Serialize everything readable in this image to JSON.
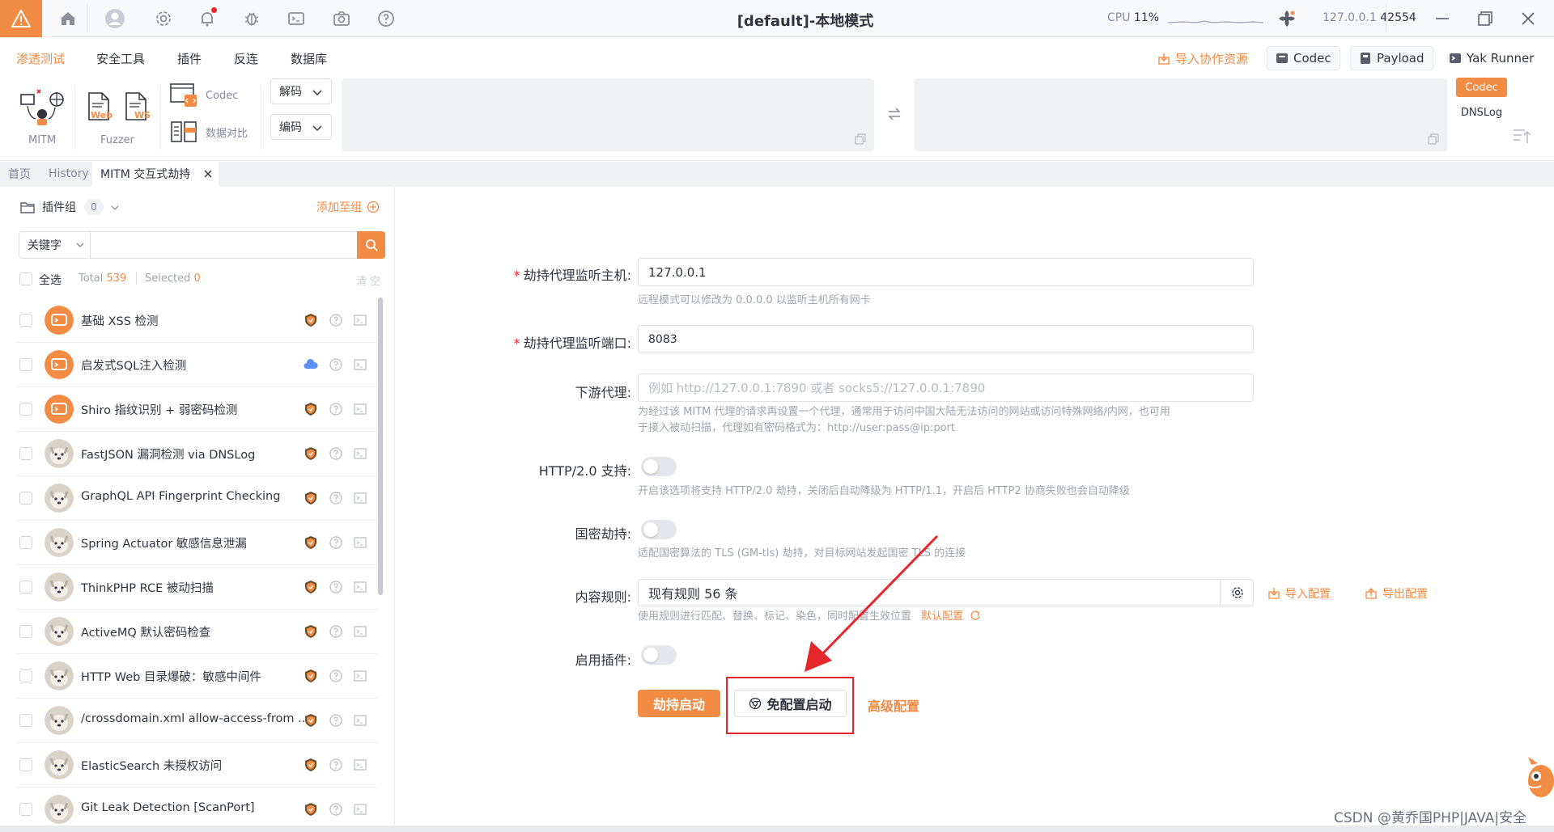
{
  "titlebar": {
    "title": "[default]-本地模式",
    "cpu_label": "CPU",
    "cpu_value": "11%",
    "host": "127.0.0.1",
    "port": "42554"
  },
  "menu": {
    "items": [
      "渗透测试",
      "安全工具",
      "插件",
      "反连",
      "数据库"
    ],
    "import_link": "导入协作资源",
    "codec_btn": "Codec",
    "payload_btn": "Payload",
    "yakrunner_btn": "Yak Runner"
  },
  "toolbar": {
    "mitm_label": "MITM",
    "web_label": "Web",
    "ws_label": "WS",
    "fuzzer_label": "Fuzzer",
    "codec_label": "Codec",
    "diff_label": "数据对比",
    "decode_select": "解码",
    "encode_select": "编码",
    "side_tab_codec": "Codec",
    "side_tab_dnslog": "DNSLog"
  },
  "tabs": [
    "首页",
    "History",
    "MITM 交互式劫持"
  ],
  "left": {
    "group_label": "插件组",
    "group_count": "0",
    "add_group": "添加至组",
    "keyword_select": "关键字",
    "select_all": "全选",
    "total_label": "Total",
    "total_value": "539",
    "selected_label": "Selected",
    "selected_value": "0",
    "clear": "清 空",
    "plugins": [
      "基础 XSS 检测",
      "启发式SQL注入检测",
      "Shiro 指纹识别 + 弱密码检测",
      "FastJSON 漏洞检测 via DNSLog",
      "GraphQL API Fingerprint Checking",
      "Spring Actuator 敏感信息泄漏",
      "ThinkPHP RCE 被动扫描",
      "ActiveMQ 默认密码检查",
      "HTTP Web 目录爆破：敏感中间件",
      "/crossdomain.xml allow-access-from ...",
      "ElasticSearch 未授权访问",
      "Git Leak Detection [ScanPort]"
    ]
  },
  "form": {
    "host_label": "劫持代理监听主机:",
    "host_value": "127.0.0.1",
    "host_help": "远程模式可以修改为 0.0.0.0 以监听主机所有网卡",
    "port_label": "劫持代理监听端口:",
    "port_value": "8083",
    "downstream_label": "下游代理:",
    "downstream_placeholder": "例如 http://127.0.0.1:7890 或者 socks5://127.0.0.1:7890",
    "downstream_help_1": "为经过该 MITM 代理的请求再设置一个代理，通常用于访问中国大陆无法访问的网站或访问特殊网络/内网，也可用",
    "downstream_help_2": "于接入被动扫描，代理如有密码格式为：http://user:pass@ip:port",
    "http2_label": "HTTP/2.0 支持:",
    "http2_help": "开启该选项将支持 HTTP/2.0 劫持，关闭后自动降级为 HTTP/1.1，开启后 HTTP2 协商失败也会自动降级",
    "gm_label": "国密劫持:",
    "gm_help": "适配国密算法的 TLS (GM-tls) 劫持，对目标网站发起国密 TLS 的连接",
    "rules_label": "内容规则:",
    "rules_value": "现有规则 56 条",
    "import_config": "导入配置",
    "export_config": "导出配置",
    "rules_help": "使用规则进行匹配、替换、标记、染色，同时配置生效位置",
    "default_config": "默认配置",
    "plugins_label": "启用插件:",
    "start_btn": "劫持启动",
    "free_start_btn": "免配置启动",
    "advanced_link": "高级配置"
  },
  "watermark": "CSDN @黄乔国PHP|JAVA|安全",
  "colors": {
    "accent": "#f28b44",
    "annotation": "#e5262b"
  }
}
